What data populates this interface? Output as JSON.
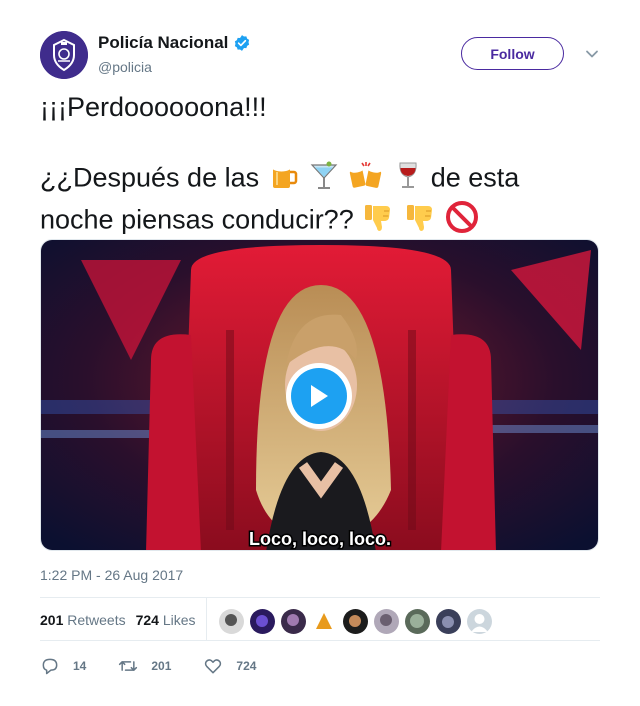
{
  "author": {
    "name": "Policía Nacional",
    "handle": "@policia",
    "verified": true,
    "avatar_color": "#3f2c8c"
  },
  "follow_label": "Follow",
  "tweet": {
    "line1": "¡¡¡Perdoooooona!!!",
    "line2_start": "¿¿Después de las",
    "line2_emojis": [
      "beer-mug-icon",
      "cocktail-glass-icon",
      "clinking-beer-mugs-icon",
      "wine-glass-icon"
    ],
    "line2_mid": "de esta",
    "line3": "noche piensas conducir??",
    "line3_emojis": [
      "thumbs-down-icon",
      "thumbs-down-icon",
      "prohibited-icon"
    ]
  },
  "media": {
    "type": "gif",
    "caption": "Loco, loco, loco."
  },
  "timestamp": "1:22 PM - 26 Aug 2017",
  "stats": {
    "retweets_count": "201",
    "retweets_label": "Retweets",
    "likes_count": "724",
    "likes_label": "Likes"
  },
  "actions": {
    "replies": "14",
    "retweets": "201",
    "likes": "724"
  },
  "colors": {
    "accent": "#1da1f2",
    "follow": "#4a2aa0",
    "muted": "#657786"
  }
}
